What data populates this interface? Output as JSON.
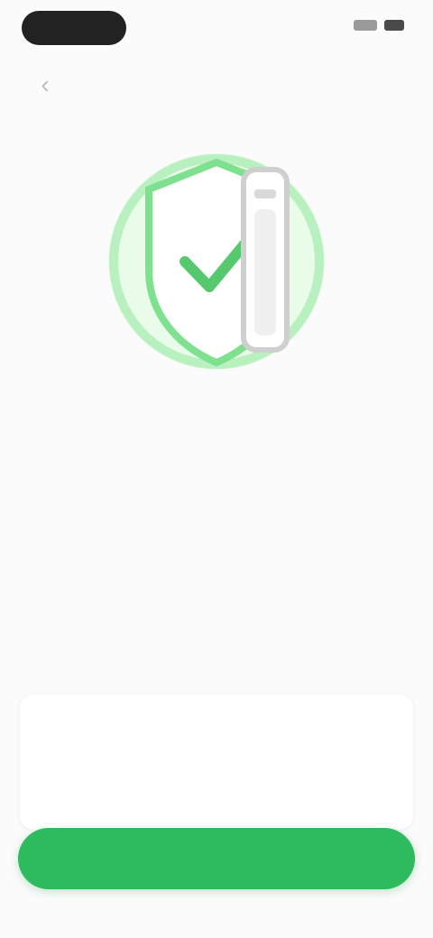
{
  "nav": {
    "title": "",
    "back_icon": "chevron-left-icon"
  },
  "hero": {
    "icon": "shield-check-illustration",
    "accent": "#7fe08f",
    "accent_light": "#cdf5d2"
  },
  "content": {
    "heading": "",
    "paragraph_1": "",
    "paragraph_2": ""
  },
  "card": {
    "title": "",
    "text": ""
  },
  "primary_button": {
    "label": "",
    "color": "#2dbb5d"
  }
}
